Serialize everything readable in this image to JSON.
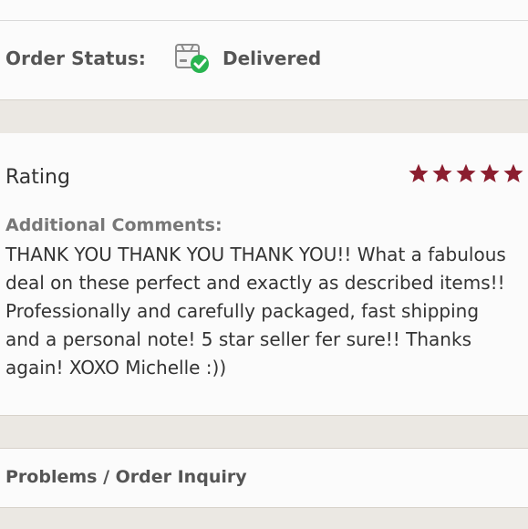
{
  "order_status": {
    "label": "Order Status:",
    "value": "Delivered",
    "icon": "package-delivered-icon",
    "status_color": "#28b450"
  },
  "review": {
    "title": "Rating",
    "stars": 5,
    "star_color": "#8b1e2f",
    "comments_label": "Additional Comments:",
    "comments_text": "THANK YOU THANK YOU THANK YOU!! What a fabulous deal on these perfect and exactly as described items!! Professionally and carefully packaged, fast shipping and a personal note! 5 star seller fer sure!! Thanks again! XOXO Michelle :))"
  },
  "problems": {
    "label": "Problems / Order Inquiry"
  }
}
